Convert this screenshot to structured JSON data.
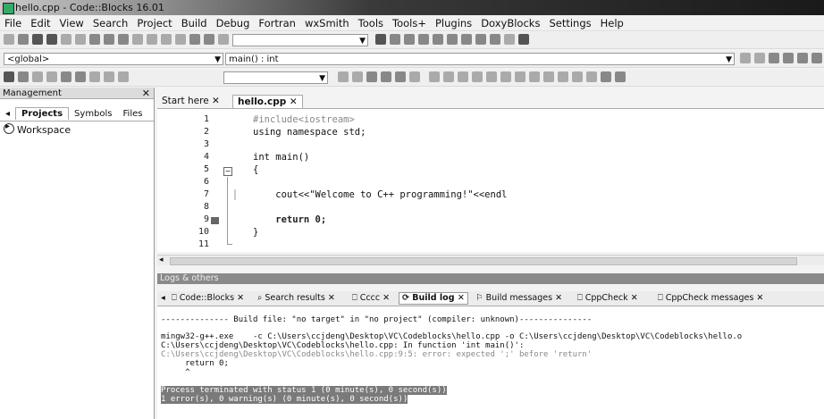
{
  "window": {
    "title": "hello.cpp - Code::Blocks 16.01"
  },
  "menu": [
    "File",
    "Edit",
    "View",
    "Search",
    "Project",
    "Build",
    "Debug",
    "Fortran",
    "wxSmith",
    "Tools",
    "Tools+",
    "Plugins",
    "DoxyBlocks",
    "Settings",
    "Help"
  ],
  "scope_bar": {
    "scope": "<global>",
    "function": "main() : int"
  },
  "management": {
    "title": "Management",
    "tabs": [
      "Projects",
      "Symbols",
      "Files"
    ],
    "active_tab": "Projects",
    "tree": [
      "Workspace"
    ]
  },
  "editor": {
    "tabs": [
      "Start here",
      "hello.cpp"
    ],
    "active_tab": "hello.cpp",
    "lines": [
      {
        "n": "1",
        "text": "#include<iostream>"
      },
      {
        "n": "2",
        "text": "using namespace std;"
      },
      {
        "n": "3",
        "text": ""
      },
      {
        "n": "4",
        "text": "int main()"
      },
      {
        "n": "5",
        "text": "{"
      },
      {
        "n": "6",
        "text": ""
      },
      {
        "n": "7",
        "text": "    cout<<\"Welcome to C++ programming!\"<<endl"
      },
      {
        "n": "8",
        "text": ""
      },
      {
        "n": "9",
        "text": "    return 0;"
      },
      {
        "n": "10",
        "text": "}"
      },
      {
        "n": "11",
        "text": ""
      }
    ],
    "error_line": "9"
  },
  "logs": {
    "title": "Logs & others",
    "tabs": [
      "Code::Blocks",
      "Search results",
      "Cccc",
      "Build log",
      "Build messages",
      "CppCheck",
      "CppCheck messages"
    ],
    "active_tab": "Build log",
    "lines": [
      {
        "text": "-------------- Build file: \"no target\" in \"no project\" (compiler: unknown)---------------",
        "style": "normal"
      },
      {
        "text": "mingw32-g++.exe    -c C:\\Users\\ccjdeng\\Desktop\\VC\\Codeblocks\\hello.cpp -o C:\\Users\\ccjdeng\\Desktop\\VC\\Codeblocks\\hello.o",
        "style": "normal"
      },
      {
        "text": "C:\\Users\\ccjdeng\\Desktop\\VC\\Codeblocks\\hello.cpp: In function 'int main()':",
        "style": "normal"
      },
      {
        "text": "C:\\Users\\ccjdeng\\Desktop\\VC\\Codeblocks\\hello.cpp:9:5: error: expected ';' before 'return'",
        "style": "gray"
      },
      {
        "text": "     return 0;",
        "style": "normal"
      },
      {
        "text": "     ^",
        "style": "normal"
      },
      {
        "text": "Process terminated with status 1 (0 minute(s), 0 second(s))",
        "style": "highlight"
      },
      {
        "text": "1 error(s), 0 warning(s) (0 minute(s), 0 second(s))",
        "style": "highlight"
      }
    ]
  }
}
